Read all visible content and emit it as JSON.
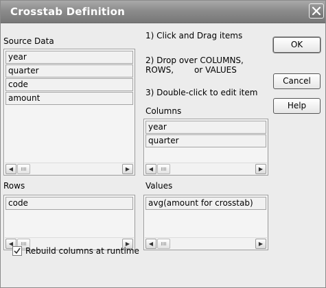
{
  "window": {
    "title": "Crosstab Definition"
  },
  "source_data": {
    "label": "Source Data",
    "items": [
      "year",
      "quarter",
      "code",
      "amount"
    ]
  },
  "instructions": {
    "step1": "1) Click and Drag items",
    "step2_line1": "2) Drop over COLUMNS,",
    "step2_line2_a": "ROWS,",
    "step2_line2_b": "or VALUES",
    "step3": "3) Double-click to edit item"
  },
  "columns": {
    "label": "Columns",
    "items": [
      "year",
      "quarter"
    ]
  },
  "rows": {
    "label": "Rows",
    "items": [
      "code"
    ]
  },
  "values": {
    "label": "Values",
    "items": [
      "avg(amount for crosstab)"
    ]
  },
  "buttons": {
    "ok": "OK",
    "cancel": "Cancel",
    "help": "Help"
  },
  "rebuild": {
    "label": "Rebuild columns at runtime",
    "checked": true
  },
  "icons": {
    "close": "close-icon",
    "scroll_left": "chevron-left-icon",
    "scroll_right": "chevron-right-icon",
    "checkmark": "checkmark-icon"
  }
}
